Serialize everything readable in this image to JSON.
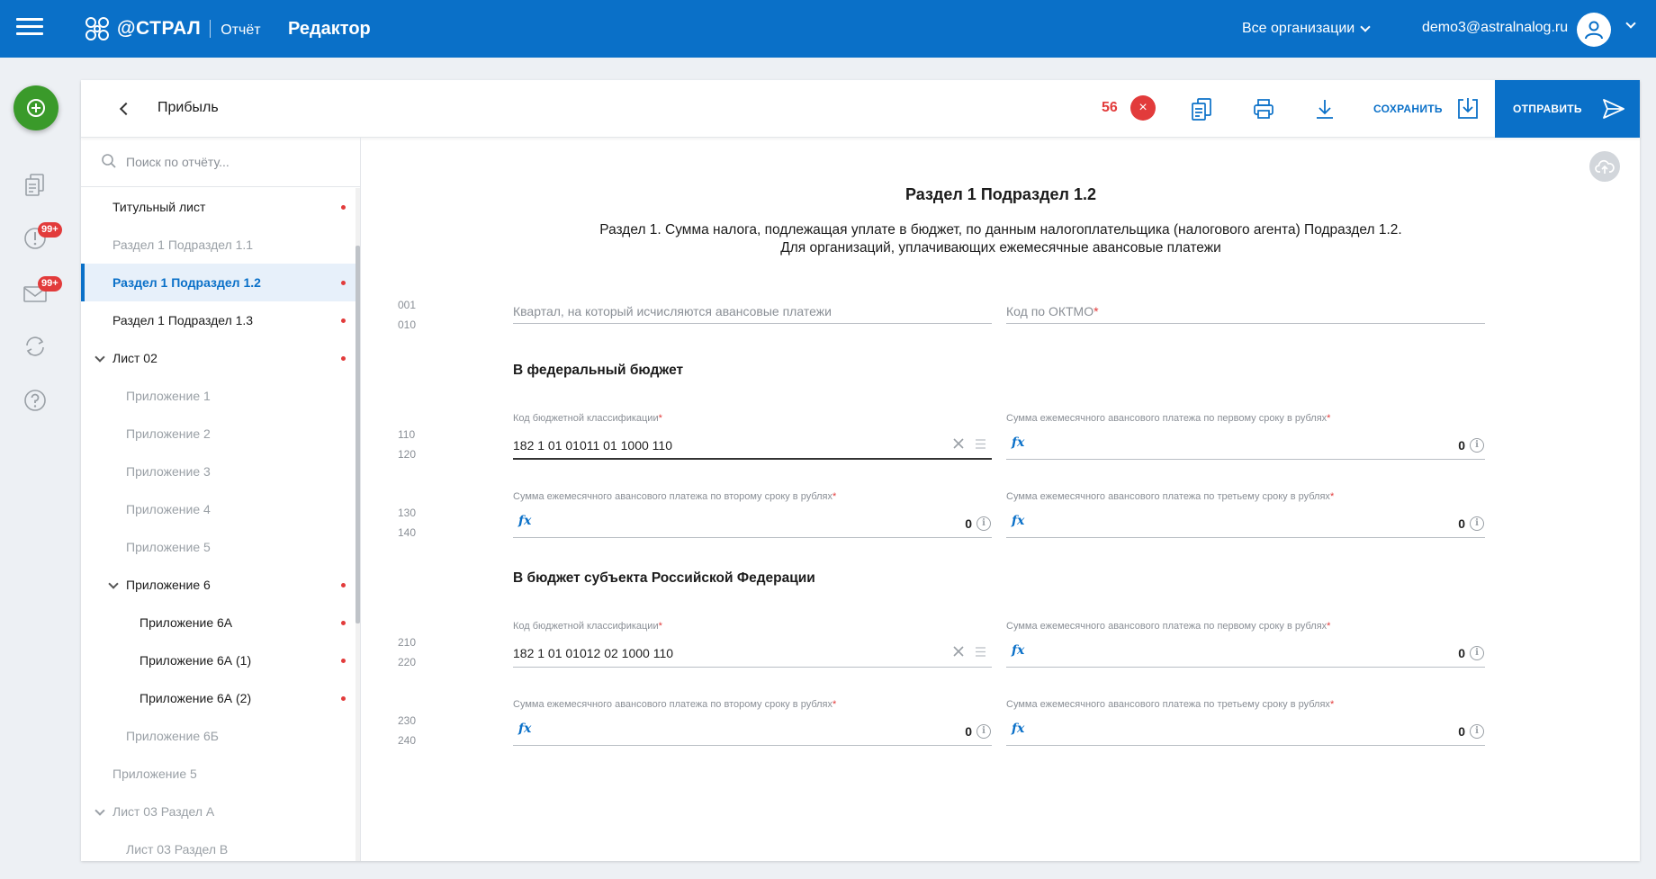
{
  "topbar": {
    "logo_text": "@СТРАЛ",
    "logo_sub": "Отчёт",
    "app_title": "Редактор",
    "org_select": "Все организации",
    "user_email": "demo3@astralnalog.ru"
  },
  "rail": {
    "badge_requests": "99+",
    "badge_messages": "99+"
  },
  "header": {
    "report_name": "Прибыль",
    "error_count": "56",
    "error_icon": "×",
    "save_label": "СОХРАНИТЬ",
    "send_label": "ОТПРАВИТЬ"
  },
  "sidebar": {
    "search_placeholder": "Поиск по отчёту...",
    "items": [
      {
        "label": "Титульный лист"
      },
      {
        "label": "Раздел 1 Подраздел 1.1"
      },
      {
        "label": "Раздел 1 Подраздел 1.2"
      },
      {
        "label": "Раздел 1 Подраздел 1.3"
      },
      {
        "label": "Лист 02"
      },
      {
        "label": "Приложение 1"
      },
      {
        "label": "Приложение 2"
      },
      {
        "label": "Приложение 3"
      },
      {
        "label": "Приложение 4"
      },
      {
        "label": "Приложение 5"
      },
      {
        "label": "Приложение 6"
      },
      {
        "label": "Приложение 6А"
      },
      {
        "label": "Приложение 6А (1)"
      },
      {
        "label": "Приложение 6А (2)"
      },
      {
        "label": "Приложение 6Б"
      },
      {
        "label": "Приложение 5"
      },
      {
        "label": "Лист 03 Раздел А"
      },
      {
        "label": "Лист 03 Раздел В"
      }
    ]
  },
  "form": {
    "title": "Раздел 1 Подраздел 1.2",
    "description": "Раздел 1. Сумма налога, подлежащая уплате в бюджет, по данным налогоплательщика (налогового агента) Подраздел 1.2. Для организаций, уплачивающих ежемесячные авансовые платежи",
    "line_numbers": [
      "001",
      "010",
      "110",
      "120",
      "130",
      "140",
      "210",
      "220",
      "230",
      "240"
    ],
    "quarter_placeholder": "Квартал, на который исчисляются авансовые платежи",
    "oktmo_placeholder": "Код по ОКТМО",
    "required_mark": "*",
    "fx_symbol": "fx",
    "info_symbol": "i",
    "federal": {
      "title": "В федеральный бюджет",
      "kbk_label": "Код бюджетной классификации",
      "kbk_value": "182 1 01 01011 01 1000 110",
      "pay1_label": "Сумма ежемесячного авансового платежа по первому сроку в рублях",
      "pay1_value": "0",
      "pay2_label": "Сумма ежемесячного авансового платежа по второму сроку в рублях",
      "pay2_value": "0",
      "pay3_label": "Сумма ежемесячного авансового платежа по третьему сроку в рублях",
      "pay3_value": "0"
    },
    "regional": {
      "title": "В бюджет субъекта Российской Федерации",
      "kbk_label": "Код бюджетной классификации",
      "kbk_value": "182 1 01 01012 02 1000 110",
      "pay1_label": "Сумма ежемесячного авансового платежа по первому сроку в рублях",
      "pay1_value": "0",
      "pay2_label": "Сумма ежемесячного авансового платежа по второму сроку в рублях",
      "pay2_value": "0",
      "pay3_label": "Сумма ежемесячного авансового платежа по третьему сроку в рублях",
      "pay3_value": "0"
    }
  },
  "colors": {
    "brand": "#0a70c8",
    "error": "#e23b3b",
    "fab": "#3a9a2a"
  }
}
